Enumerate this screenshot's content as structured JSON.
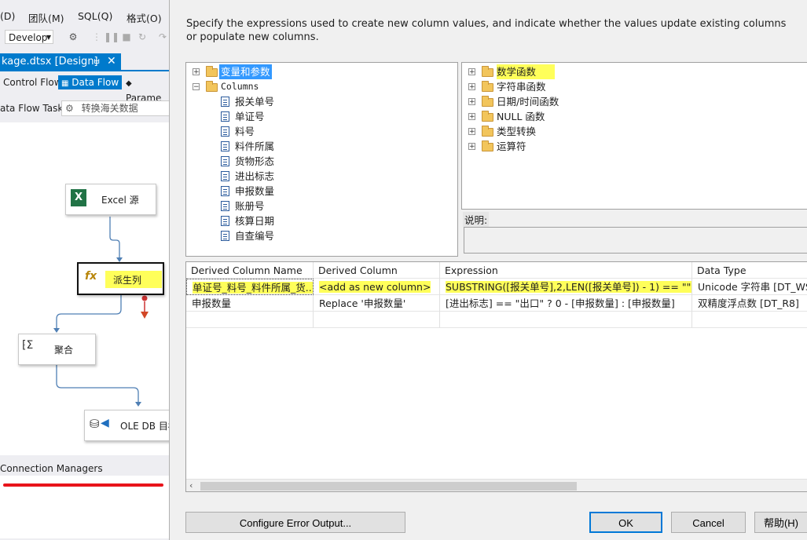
{
  "vs": {
    "menu": [
      "(D)",
      "团队(M)",
      "SQL(Q)",
      "格式(O)"
    ],
    "config_combo": "Develop",
    "doc_tab": {
      "title": "kage.dtsx [Design]",
      "pin": "ㅂ",
      "close": "✕"
    },
    "sub_tabs": [
      "Control Flow",
      "Data Flow",
      "Parame"
    ],
    "task_label": "ata Flow Task:",
    "task_value": "转换海关数据",
    "nodes": {
      "excel": "Excel 源",
      "derived": "派生列",
      "aggregate": "聚合",
      "oledb": "OLE DB 目标"
    },
    "connection_managers": "Connection Managers"
  },
  "dialog": {
    "instructions": "Specify the expressions used to create new column values, and indicate whether the values update existing columns or populate new columns.",
    "left_tree": {
      "vars": "变量和参数",
      "columns": "Columns",
      "column_items": [
        "报关单号",
        "单证号",
        "料号",
        "料件所属",
        "货物形态",
        "进出标志",
        "申报数量",
        "账册号",
        "核算日期",
        "自查编号"
      ]
    },
    "right_tree": [
      "数学函数",
      "字符串函数",
      "日期/时间函数",
      "NULL 函数",
      "类型转换",
      "运算符"
    ],
    "description_label": "说明:",
    "grid": {
      "headers": [
        "Derived Column Name",
        "Derived Column",
        "Expression",
        "Data Type"
      ],
      "rows": [
        [
          "单证号_料号_料件所属_货...",
          "<add as new column>",
          "SUBSTRING([报关单号],2,LEN([报关单号]) - 1) == \"\" ...",
          "Unicode 字符串 [DT_WS..."
        ],
        [
          "申报数量",
          "Replace '申报数量'",
          "[进出标志] == \"出口\" ? 0 - [申报数量] : [申报数量]",
          "双精度浮点数 [DT_R8]"
        ]
      ]
    },
    "buttons": {
      "error_output": "Configure Error Output...",
      "ok": "OK",
      "cancel": "Cancel",
      "help": "帮助(H)"
    },
    "colors": {
      "highlight": "#ffff5a",
      "selection": "#3399ff",
      "accent": "#007acc"
    }
  }
}
